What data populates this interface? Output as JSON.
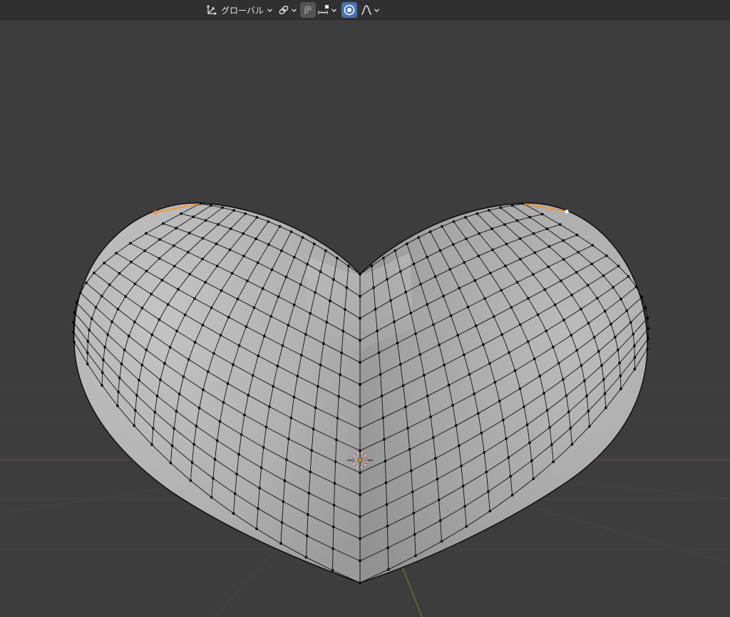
{
  "app": "Blender",
  "header": {
    "orientation": {
      "label": "グローバル",
      "icon": "transform-orientation-icon"
    },
    "pivot": {
      "icon": "pivot-link-icon"
    },
    "snap": {
      "icon": "snap-magnet-icon",
      "enabled": false
    },
    "snap_target": {
      "icon": "snap-increment-icon"
    },
    "proportional_editing": {
      "icon": "proportional-edit-icon",
      "enabled": true
    },
    "falloff": {
      "icon": "falloff-curve-icon"
    }
  },
  "viewport": {
    "mode": "edit-mesh",
    "object": "heart-mesh",
    "colors": {
      "background": "#3d3d3d",
      "header": "#303030",
      "mesh_face": "#b4b4b4",
      "mesh_edge": "#000000",
      "selected": "#ff8c1a",
      "x_axis": "#8a3a3a",
      "y_axis": "#6f8f2a",
      "active_toggle": "#4772b3"
    }
  }
}
